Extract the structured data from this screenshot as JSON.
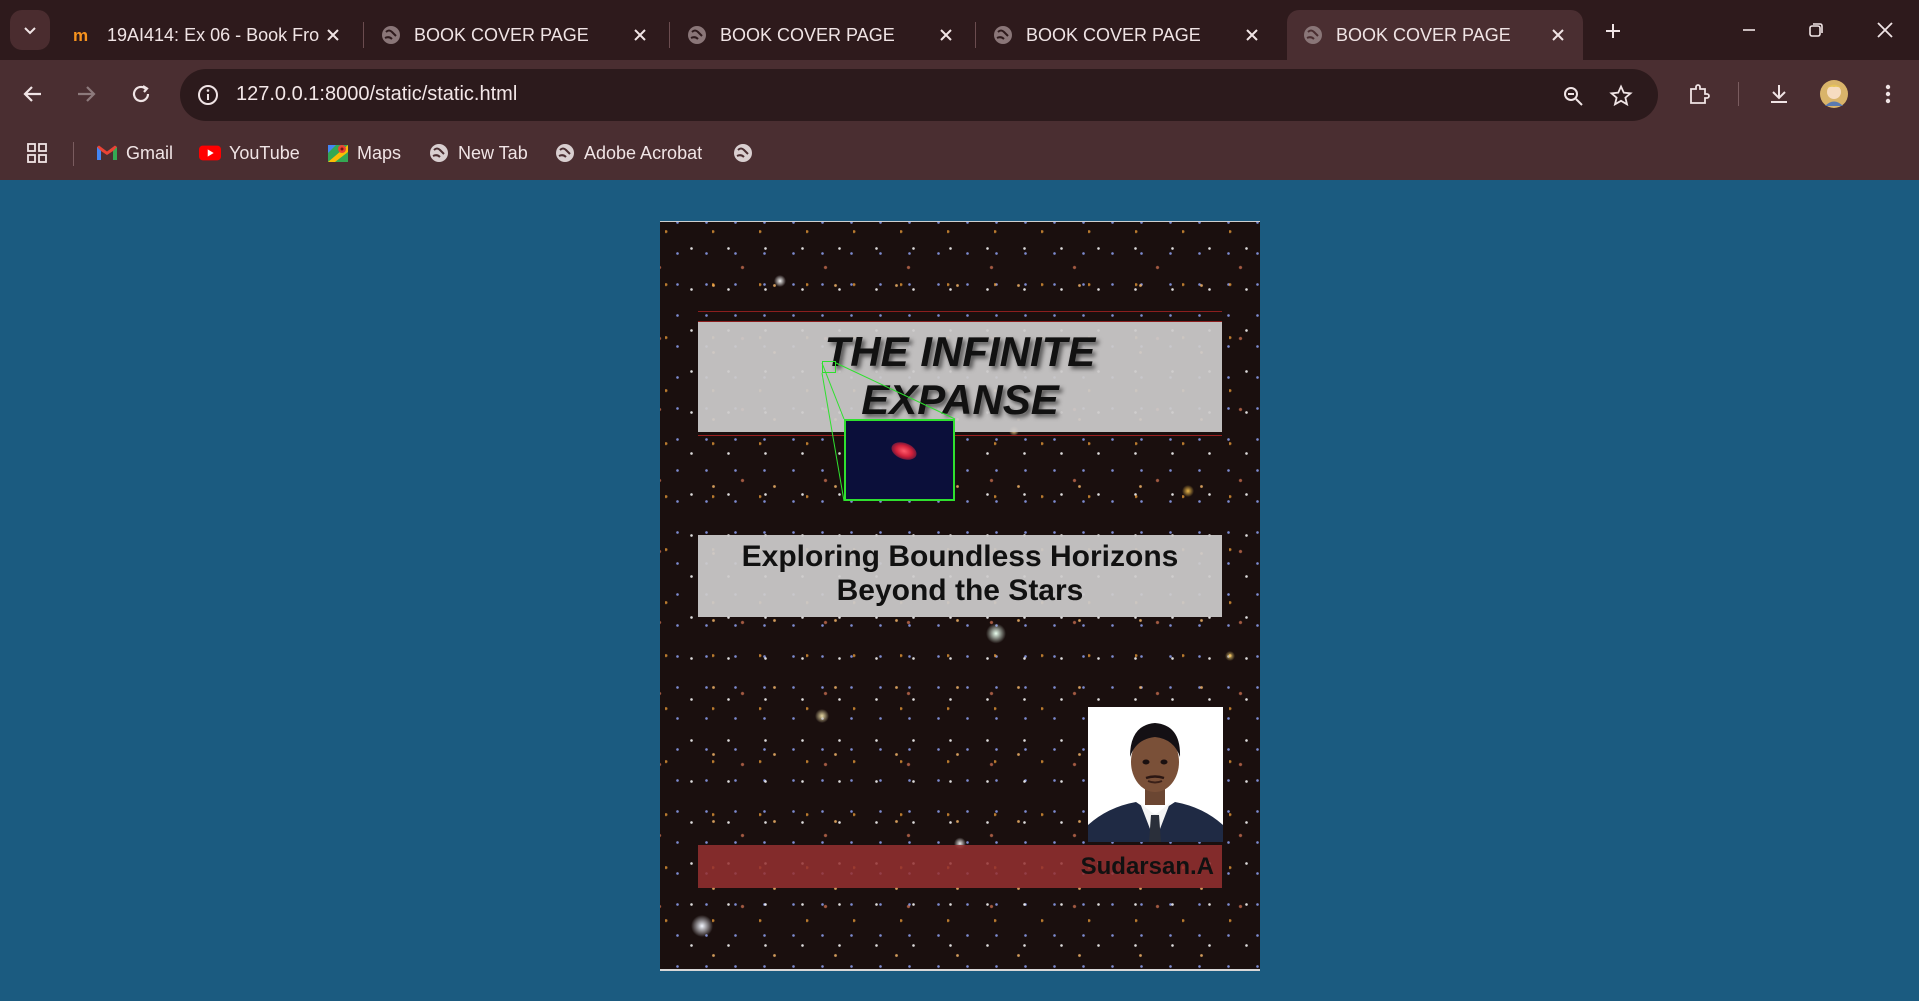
{
  "tabs": [
    {
      "title": "19AI414: Ex 06 - Book Fro",
      "favicon": "moodle-icon",
      "active": false
    },
    {
      "title": "BOOK COVER PAGE",
      "favicon": "globe-icon",
      "active": false
    },
    {
      "title": "BOOK COVER PAGE",
      "favicon": "globe-icon",
      "active": false
    },
    {
      "title": "BOOK COVER PAGE",
      "favicon": "globe-icon",
      "active": false
    },
    {
      "title": "BOOK COVER PAGE",
      "favicon": "globe-icon",
      "active": true
    }
  ],
  "address_bar": {
    "url": "127.0.0.1:8000/static/static.html"
  },
  "bookmarks": [
    {
      "label": "Gmail",
      "icon": "gmail-icon"
    },
    {
      "label": "YouTube",
      "icon": "youtube-icon"
    },
    {
      "label": "Maps",
      "icon": "maps-icon"
    },
    {
      "label": "New Tab",
      "icon": "globe-icon"
    },
    {
      "label": "Adobe Acrobat",
      "icon": "globe-icon"
    },
    {
      "label": "",
      "icon": "globe-icon"
    }
  ],
  "cover": {
    "title_line1": "THE INFINITE",
    "title_line2": "EXPANSE",
    "subtitle_line1": "Exploring Boundless Horizons",
    "subtitle_line2": "Beyond the Stars",
    "author": "Sudarsan.A"
  },
  "colors": {
    "page_background": "#1b5b80",
    "chrome_dark": "#2e1a1c",
    "chrome": "#4a2e31",
    "author_bar": "#963030",
    "inset_border": "#2fe02f"
  }
}
